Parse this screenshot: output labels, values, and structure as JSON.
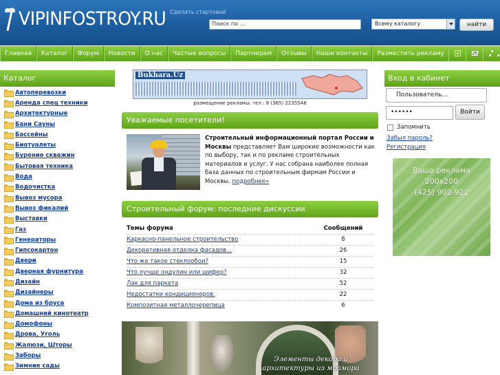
{
  "header": {
    "logo_text": "VIPINFOSTROY.RU",
    "start_page_link": "Сделать стартовой",
    "search_placeholder": "Поиск по ...",
    "search_scope": "Всему каталогу",
    "search_button": "найти"
  },
  "nav": {
    "items": [
      "Главная",
      "Каталог",
      "Форум",
      "Новости",
      "О нас",
      "Частые вопросы",
      "Партнерам",
      "Отзывы",
      "Наши контакты",
      "Разместить рекламу"
    ]
  },
  "catalog": {
    "title": "Каталог",
    "items": [
      "Автоперевозки",
      "Аренда спец техники",
      "Архитектурные",
      "Бани Сауны",
      "Бассейны",
      "Биотуалеты",
      "Бурение скважин",
      "Бытовая техника",
      "Вода",
      "Водочистка",
      "Вывоз мусора",
      "Вывоз фикалий",
      "Выставки",
      "Газ",
      "Генераторы",
      "Гипсокартон",
      "Двери",
      "Дверная фурнитура",
      "Дизайн",
      "Дизайнеры",
      "Дома из бруса",
      "Домашний кинотеатр",
      "Домофоны",
      "Дрова, Уголь",
      "Жалюзи, Шторы",
      "Заборы",
      "Зимние сады"
    ]
  },
  "top_banner": {
    "brand": "Bukhara.Uz",
    "caption": "размещение рекламы: тел.: 8 (365) 2235548"
  },
  "welcome": {
    "title": "Уважаемые посетители!",
    "bold_text": "Строительный информационный портал России и Москвы",
    "text": " представляет Вам широкие возможности как по выбору, так и по рекламе строительных материалов и услуг. У нас собрана наиболее полная база данных по строительным фирмам России и Москвы. ",
    "more_link": "подробнее»"
  },
  "forum": {
    "title": "Строительный форум: последние дискуссии",
    "col_topics": "Темы форума",
    "col_messages": "Сообщений",
    "rows": [
      {
        "topic": "Каркасно-панельное строительство",
        "count": "8"
      },
      {
        "topic": "Декоративная отделка фасадов...",
        "count": "26"
      },
      {
        "topic": "Что же такое стеклообои?",
        "count": "15"
      },
      {
        "topic": "Что лучше ондулин или шифер?",
        "count": "32"
      },
      {
        "topic": "Лак для паркета",
        "count": "52"
      },
      {
        "topic": "Недостатки кондиционеров.",
        "count": "22"
      },
      {
        "topic": "Композитная металлочерепица",
        "count": "6"
      }
    ]
  },
  "bottom_banner": {
    "line1": "Элементы декора и",
    "line2": "архитектуры из мрамора"
  },
  "login": {
    "title": "Вход в кабинет",
    "username_value": "Пользователь...",
    "password_value": "••••••",
    "submit": "Войти",
    "remember": "Запомнить",
    "forgot": "Забыл пароль?",
    "register": "Регистрация"
  },
  "right_ad": {
    "line1": "Ваша реклама",
    "line2": "200x200",
    "line3": "(425) 902-922"
  }
}
